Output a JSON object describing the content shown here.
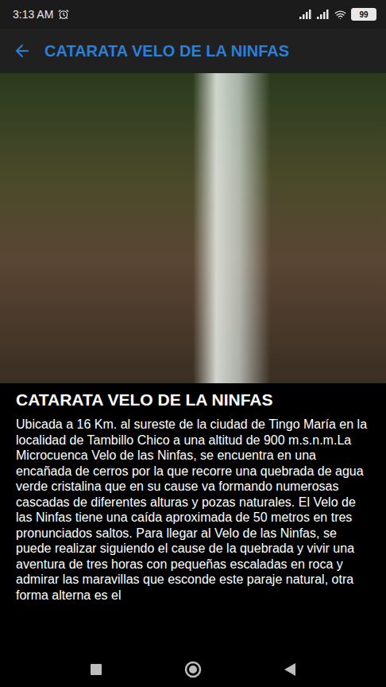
{
  "status_bar": {
    "time": "3:13 AM",
    "battery": "99"
  },
  "header": {
    "title": "CATARATA VELO DE LA NINFAS"
  },
  "article": {
    "title": "CATARATA VELO DE LA NINFAS",
    "body": "Ubicada a 16 Km. al sureste de la ciudad de Tingo María en la localidad de Tambillo Chico a una altitud de 900 m.s.n.m.La Microcuenca Velo de las Ninfas, se encuentra en una encañada de cerros por la que recorre una quebrada de agua verde cristalina que en su cause va formando numerosas cascadas de diferentes alturas y pozas naturales. El Velo de las Ninfas tiene una caída aproximada de 50 metros en tres pronunciados saltos. Para llegar al Velo de las Ninfas, se puede realizar siguiendo el cause de la quebrada y vivir una aventura de tres horas con pequeñas escaladas en roca y admirar las maravillas que esconde este paraje natural, otra forma alterna es el"
  }
}
